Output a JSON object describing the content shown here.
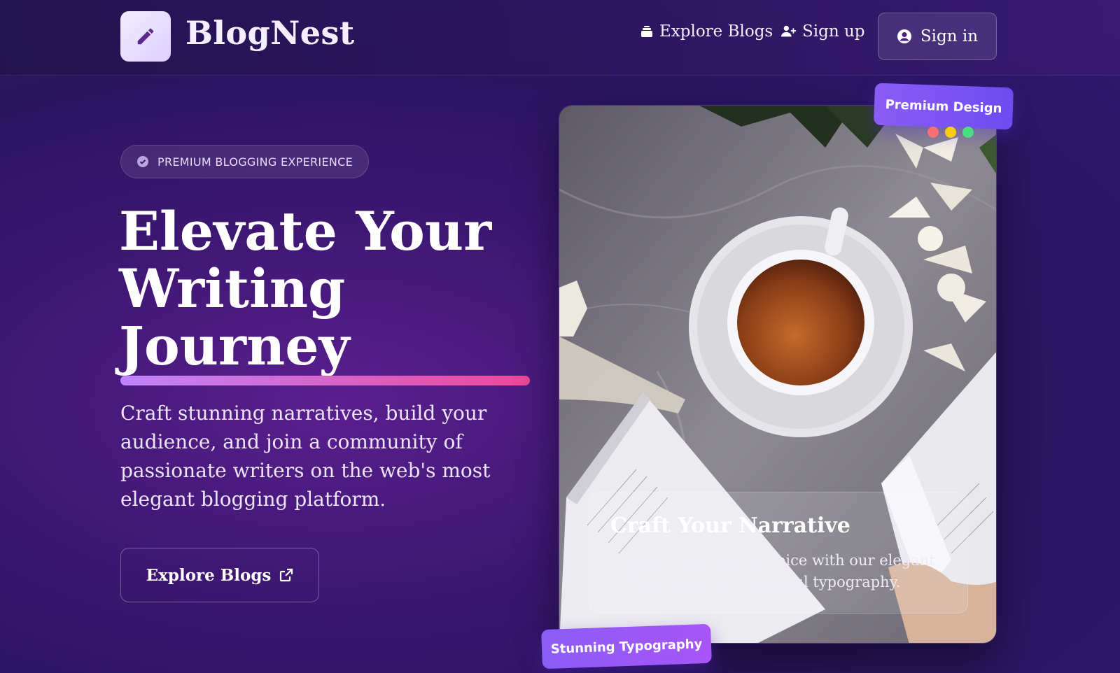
{
  "nav": {
    "brand": "BlogNest",
    "links": [
      {
        "label": "Explore Blogs",
        "icon": "layers-icon"
      },
      {
        "label": "Sign up",
        "icon": "user-plus-icon"
      }
    ],
    "signin_label": "Sign in"
  },
  "hero": {
    "badge": "PREMIUM BLOGGING EXPERIENCE",
    "title_lines": [
      "Elevate Your",
      "Writing",
      "Journey"
    ],
    "description": "Craft stunning narratives, build your audience, and join a community of passionate writers on the web's most elegant blogging platform.",
    "cta_label": "Explore Blogs"
  },
  "card": {
    "title": "Craft Your Narrative",
    "description": "Express your unique voice with our elegant writing tools and beautiful typography.",
    "tag_top": "Premium Design",
    "tag_bottom": "Stunning Typography"
  },
  "colors": {
    "accent_gradient_start": "#c084fc",
    "accent_gradient_end": "#ec4899",
    "tag_purple": "#8b5cf6",
    "dot_red": "#f87171",
    "dot_yellow": "#facc15",
    "dot_green": "#4ade80"
  }
}
